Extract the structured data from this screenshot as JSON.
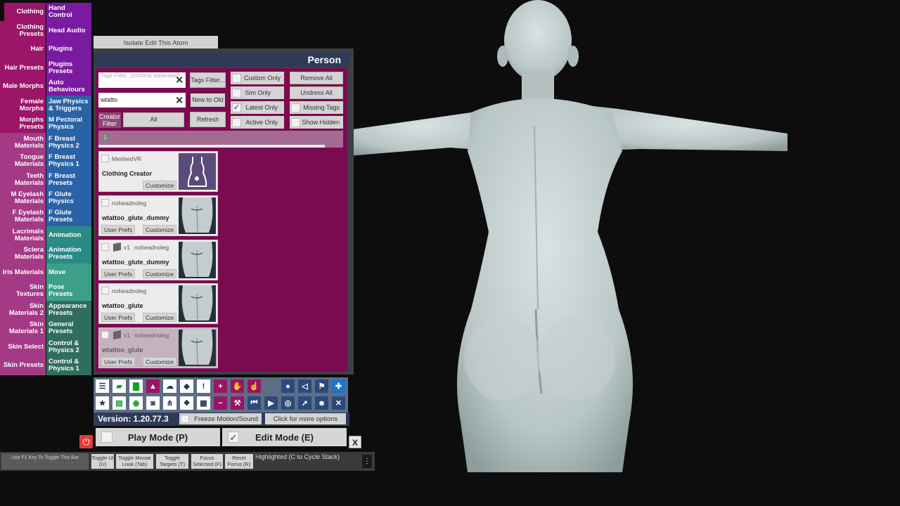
{
  "left_menu": [
    {
      "l": "Clothing",
      "r": "Hand Control",
      "lc": "#9b1568",
      "rc": "#7a1aa0"
    },
    {
      "l": "Clothing Presets",
      "r": "Head Audio",
      "lc": "#9b1568",
      "rc": "#7a1aa0"
    },
    {
      "l": "Hair",
      "r": "Plugins",
      "lc": "#9b1568",
      "rc": "#7a1aa0"
    },
    {
      "l": "Hair Presets",
      "r": "Plugins Presets",
      "lc": "#9b1568",
      "rc": "#7a1aa0"
    },
    {
      "l": "Male Morphs",
      "r": "Auto Behaviours",
      "lc": "#9b1568",
      "rc": "#7a1aa0"
    },
    {
      "l": "Female Morphs",
      "r": "Jaw Physics & Triggers",
      "lc": "#9b1568",
      "rc": "#2a62a6"
    },
    {
      "l": "Morphs Presets",
      "r": "M Pectoral Physics",
      "lc": "#9b1568",
      "rc": "#2a62a6"
    },
    {
      "l": "Mouth Materials",
      "r": "F Breast Physics 2",
      "lc": "#a43a86",
      "rc": "#2a62a6"
    },
    {
      "l": "Tongue Materials",
      "r": "F Breast Physics 1",
      "lc": "#a43a86",
      "rc": "#2a62a6"
    },
    {
      "l": "Teeth Materials",
      "r": "F Breast Presets",
      "lc": "#a43a86",
      "rc": "#2a62a6"
    },
    {
      "l": "M Eyelash Materials",
      "r": "F Glute Physics",
      "lc": "#a43a86",
      "rc": "#2a62a6"
    },
    {
      "l": "F Eyelash Materials",
      "r": "F Glute Presets",
      "lc": "#a43a86",
      "rc": "#2a62a6"
    },
    {
      "l": "Lacrimals Materials",
      "r": "Animation",
      "lc": "#a43a86",
      "rc": "#2a8a86"
    },
    {
      "l": "Sclera Materials",
      "r": "Animation Presets",
      "lc": "#a43a86",
      "rc": "#2a8a86"
    },
    {
      "l": "Iris Materials",
      "r": "Move",
      "lc": "#a43a86",
      "rc": "#3aa08a"
    },
    {
      "l": "Skin Textures",
      "r": "Pose Presets",
      "lc": "#a43a86",
      "rc": "#3aa08a"
    },
    {
      "l": "Skin Materials 2",
      "r": "Appearance Presets",
      "lc": "#a43a86",
      "rc": "#2f6e5e"
    },
    {
      "l": "Skin Materials 1",
      "r": "General Presets",
      "lc": "#a43a86",
      "rc": "#2f6e5e"
    },
    {
      "l": "Skin Select",
      "r": "Control & Physics 2",
      "lc": "#a43a86",
      "rc": "#2f6e5e"
    },
    {
      "l": "Skin Presets",
      "r": "Control & Physics 1",
      "lc": "#a43a86",
      "rc": "#2f6e5e"
    }
  ],
  "isolate_label": "Isolate Edit This Atom",
  "panel_title": "Person",
  "tags_filter_placeholder": "Tags Filter...(comma seperated)",
  "search_value": "wtatto",
  "tags_filter_btn": "Tags Filter...",
  "new_to_old_btn": "New to Old",
  "refresh_btn": "Refresh",
  "creator_filter_label": "Creator Filter",
  "creator_filter_value": "All",
  "toggles": [
    {
      "label": "Custom Only",
      "checked": false
    },
    {
      "label": "Sim Only",
      "checked": false
    },
    {
      "label": "Latest Only",
      "checked": true
    },
    {
      "label": "Active Only",
      "checked": false
    }
  ],
  "remove_all": "Remove All",
  "undress_all": "Undress All",
  "missing_tags": "Missing Tags",
  "show_hidden": "Show Hidden",
  "page_number": "1",
  "items": [
    {
      "creator": "MeshedVR",
      "version": "",
      "name": "Clothing Creator",
      "user_prefs": "",
      "customize": "Customize"
    },
    {
      "creator": "noheadnoleg",
      "version": "",
      "name": "wtattoo_glute_dummy",
      "user_prefs": "User Prefs",
      "customize": "Customize"
    },
    {
      "creator": "noheadnoleg",
      "version": "v1",
      "name": "wtattoo_glute_dummy",
      "user_prefs": "User Prefs",
      "customize": "Customize"
    },
    {
      "creator": "noheadnoleg",
      "version": "",
      "name": "wtattoo_glute",
      "user_prefs": "User Prefs",
      "customize": "Customize"
    },
    {
      "creator": "noheadnoleg",
      "version": "v1",
      "name": "wtattoo_glute",
      "user_prefs": "User Prefs",
      "customize": "Customize"
    }
  ],
  "toolbar_row1": [
    "menu-icon",
    "scene-open-icon",
    "folder-icon",
    "hub-icon",
    "cloud-icon",
    "package-icon",
    "alert-icon",
    "person-add-icon",
    "hand-icon",
    "touch-icon",
    "person-icon",
    "camera-view-icon",
    "flag-icon",
    "plus-icon"
  ],
  "toolbar_row2": [
    "star-icon",
    "scene-save-icon",
    "screenshot-icon",
    "camera-icon",
    "nodes-icon",
    "dropbox-icon",
    "document-icon",
    "person-remove-icon",
    "wrench-pink-icon",
    "skip-start-icon",
    "play-icon",
    "target-icon",
    "pointer-icon",
    "people-icon",
    "tools-icon"
  ],
  "version_text": "Version: 1.20.77.3",
  "freeze_label": "Freeze Motion/Sound",
  "more_options": "Click for more options",
  "play_mode": "Play Mode (P)",
  "edit_mode": "Edit Mode (E)",
  "play_checked": false,
  "edit_checked": true,
  "close_label": "X",
  "f1_hint": "Use F1 Key To Toggle This Bar",
  "bottom_buttons": [
    {
      "label": "Toggle UI (U)"
    },
    {
      "label": "Toggle Mouse Look (Tab)"
    },
    {
      "label": "Toggle Targets (T)"
    },
    {
      "label": "Focus Selected (F)"
    },
    {
      "label": "Reset Focus (R)"
    }
  ],
  "highlighted_text": "Highlighted (C to Cycle Stack)",
  "colors": {
    "panel_bg": "#7b0a4f",
    "header": "#2f3a57",
    "figure": "#c8d2d3"
  }
}
